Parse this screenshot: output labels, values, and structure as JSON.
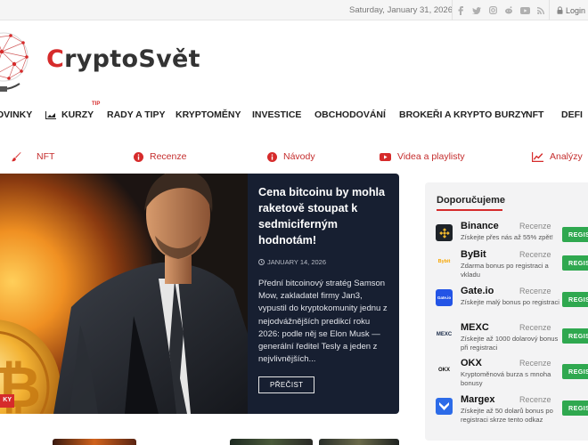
{
  "topbar": {
    "date": "Saturday, January 31, 2026",
    "social_icons": [
      "facebook-icon",
      "twitter-icon",
      "instagram-icon",
      "reddit-icon",
      "youtube-icon",
      "rss-icon"
    ],
    "login": "Login"
  },
  "header": {
    "logo_first": "C",
    "logo_rest": "ryptoSvět"
  },
  "main_nav": {
    "items": [
      "OVINKY",
      "KURZY",
      "RADY A TIPY",
      "KRYPTOMĚNY",
      "INVESTICE",
      "OBCHODOVÁNÍ",
      "BROKEŘI A KRYPTO BURZY",
      "NFT",
      "DEFI"
    ],
    "tip_badge": "TIP"
  },
  "sub_nav": {
    "items": [
      "NFT",
      "Recenze",
      "Návody",
      "Videa a playlisty",
      "Analýzy"
    ]
  },
  "hero": {
    "title": "Cena bitcoinu by mohla raketově stoupat k sedmiciferným hodnotám!",
    "date": "JANUARY 14, 2026",
    "text": "Přední bitcoinový stratég Samson Mow, zakladatel firmy Jan3, vypustil do kryptokomunity jednu z nejodvážnějších predikcí roku 2026: podle něj se Elon Musk — generální ředitel Tesly a jeden z nejvlivnějších...",
    "button": "PŘEČIST",
    "badge": "KY"
  },
  "sidebar": {
    "title": "Doporučujeme",
    "items": [
      {
        "name": "Binance",
        "review": "Recenze",
        "desc": "Získejte přes nás až 55% zpět!",
        "button": "REGISTRACE",
        "icon": "binance-icon",
        "icon_text": "",
        "color": "#1e2329"
      },
      {
        "name": "ByBit",
        "review": "Recenze",
        "desc": "Zdarma bonus po registraci a vkladu",
        "button": "REGISTRACE",
        "icon": "bybit-icon",
        "icon_text": "Bybit",
        "color": "#f2f2f2"
      },
      {
        "name": "Gate.io",
        "review": "Recenze",
        "desc": "Získejte malý bonus po registraci",
        "button": "REGISTRACE",
        "icon": "gateio-icon",
        "icon_text": "Gate.io",
        "color": "#2354e6"
      },
      {
        "name": "MEXC",
        "review": "Recenze",
        "desc": "Získejte až 1000 dolarový bonus při registraci",
        "button": "REGISTRACE",
        "icon": "mexc-icon",
        "icon_text": "MEXC",
        "color": "#f2f2f2"
      },
      {
        "name": "OKX",
        "review": "Recenze",
        "desc": "Kryptoměnová burza s mnoha bonusy",
        "button": "REGISTRACE",
        "icon": "okx-icon",
        "icon_text": "OKX",
        "color": "#f2f2f2"
      },
      {
        "name": "Margex",
        "review": "Recenze",
        "desc": "Získejte až 50 dolarů bonus po registraci skrze tento odkaz",
        "button": "REGISTRACE",
        "icon": "margex-icon",
        "icon_text": "",
        "color": "#2c6be8"
      }
    ]
  }
}
